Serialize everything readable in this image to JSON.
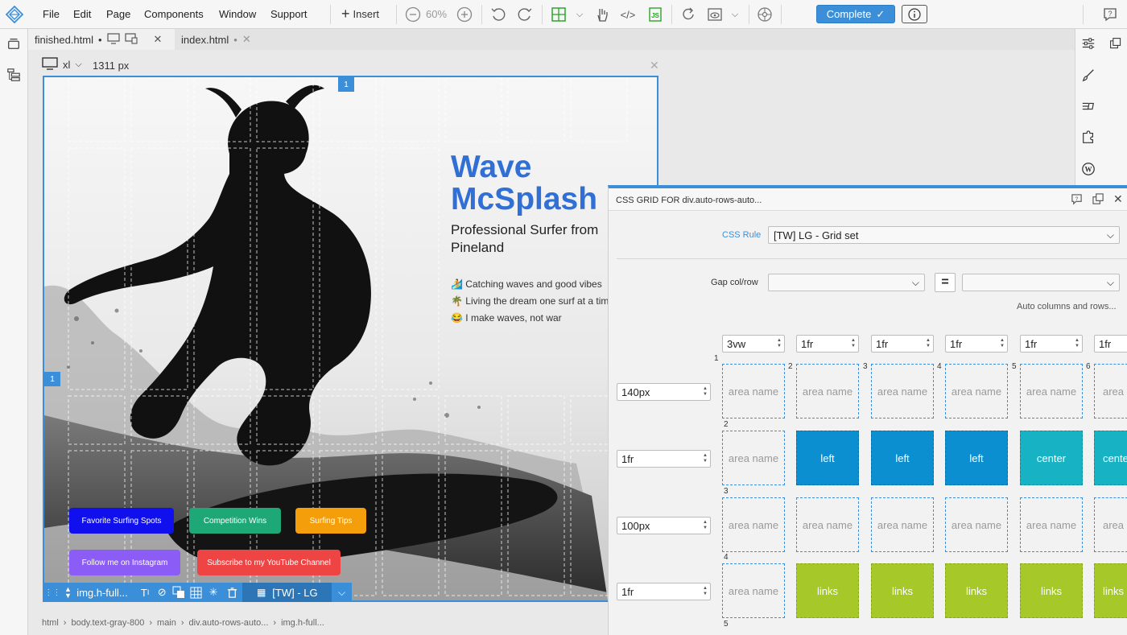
{
  "menubar": {
    "items": [
      "File",
      "Edit",
      "Page",
      "Components",
      "Window",
      "Support"
    ],
    "insert_label": "Insert",
    "zoom": "60%",
    "complete_label": "Complete"
  },
  "tabs": [
    {
      "label": "finished.html",
      "modified": "•"
    },
    {
      "label": "index.html",
      "modified": "•"
    }
  ],
  "device": {
    "breakpoint": "xl",
    "width": "1311 px"
  },
  "hero": {
    "title_line1": "Wave",
    "title_line2": "McSplash",
    "subtitle": "Professional Surfer from Pineland",
    "bullets": [
      "🏄 Catching waves and good vibes",
      "🌴 Living the dream one surf at a time",
      "😂 I make waves, not war"
    ],
    "buttons": [
      {
        "label": "Favorite Surfing Spots",
        "color": "#1010ee"
      },
      {
        "label": "Competition Wins",
        "color": "#1fa877"
      },
      {
        "label": "Surfing Tips",
        "color": "#f59e0b"
      },
      {
        "label": "Follow me on Instagram",
        "color": "#8b5cf6"
      },
      {
        "label": "Subscribe to my YouTube Channel",
        "color": "#ef4444"
      }
    ],
    "grid_badge_col": "1",
    "grid_badge_row": "1"
  },
  "sel_toolbar": {
    "element": "img.h-full...",
    "class_set": "[TW] - LG"
  },
  "breadcrumb": [
    "html",
    "body.text-gray-800",
    "main",
    "div.auto-rows-auto...",
    "img.h-full..."
  ],
  "panel": {
    "title": "CSS GRID FOR div.auto-rows-auto...",
    "css_rule_label": "CSS Rule",
    "css_rule_value": "[TW] LG - Grid set",
    "gap_label": "Gap col/row",
    "equals": "=",
    "auto_label": "Auto columns and rows...",
    "columns": [
      "3vw",
      "1fr",
      "1fr",
      "1fr",
      "1fr",
      "1fr"
    ],
    "rows": [
      "140px",
      "1fr",
      "100px",
      "1fr"
    ],
    "col_lines": [
      "1",
      "2",
      "3",
      "4",
      "5",
      "6"
    ],
    "row_lines": [
      "2",
      "3",
      "4",
      "5"
    ],
    "cells": [
      [
        "area name",
        "area name",
        "area name",
        "area name",
        "area name",
        "area name"
      ],
      [
        "area name",
        "left",
        "left",
        "left",
        "center",
        "center"
      ],
      [
        "area name",
        "area name",
        "area name",
        "area name",
        "area name",
        "area name"
      ],
      [
        "area name",
        "links",
        "links",
        "links",
        "links",
        "links"
      ]
    ]
  },
  "colors": {
    "accent": "#3b8fd9",
    "title_blue": "#2f6fd6",
    "left": "#0b8fd0",
    "center": "#17b3c4",
    "links": "#a6c929"
  }
}
